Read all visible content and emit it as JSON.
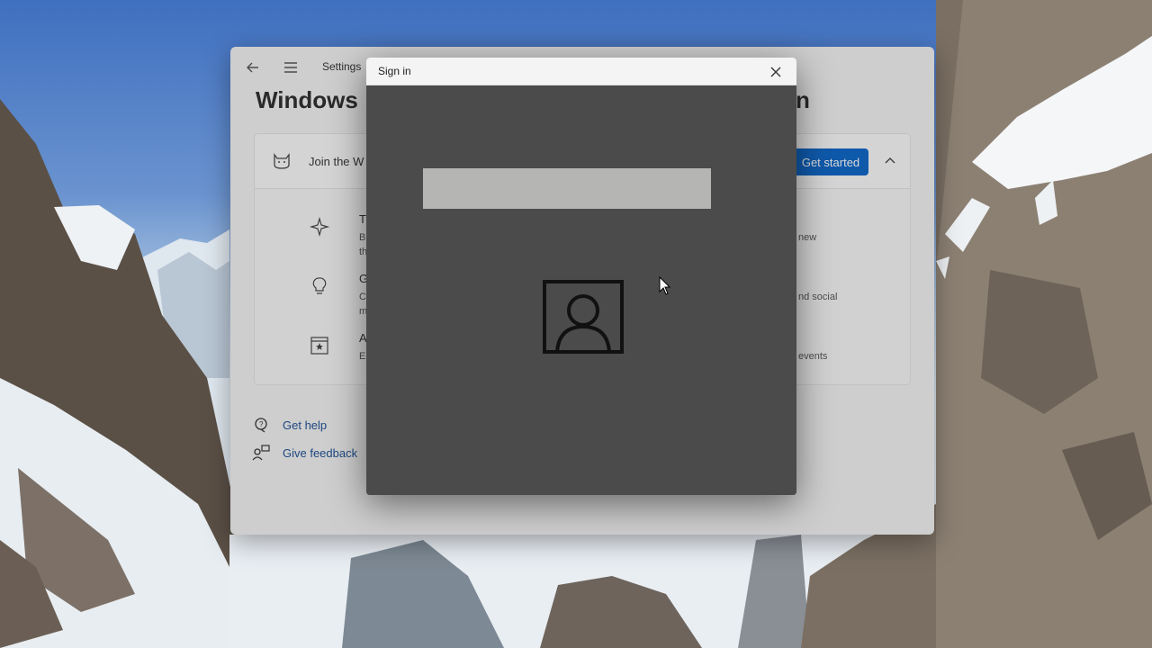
{
  "settings": {
    "app_title": "Settings",
    "page_title": "Windows",
    "page_title_tail": "n",
    "join_label": "Join the W",
    "get_started_label": "Get started",
    "benefits": [
      {
        "icon": "sparkle-icon",
        "title": "T",
        "desc": "B",
        "desc2": "th",
        "right": "new"
      },
      {
        "icon": "lightbulb-icon",
        "title": "G",
        "desc": "C",
        "desc2": "m",
        "right": "nd social"
      },
      {
        "icon": "star-badge-icon",
        "title": "A",
        "desc": "E",
        "desc2": "",
        "right": " events"
      }
    ],
    "links": {
      "get_help": "Get help",
      "give_feedback": "Give feedback"
    }
  },
  "dialog": {
    "title": "Sign in"
  }
}
